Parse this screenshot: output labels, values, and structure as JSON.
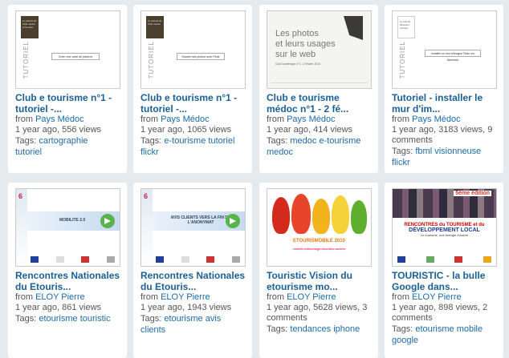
{
  "cards": [
    {
      "title": "Club e tourisme n°1 - tutoriel -...",
      "from_label": "from",
      "author": "Pays Médoc",
      "stats": "1 year ago, 556 views",
      "tags_label": "Tags:",
      "tags": [
        "cartographie",
        "tutoriel"
      ],
      "thumb": {
        "box_text": "Créer une carte de pictures",
        "vertical_text": "TUTORIEL",
        "block_text": "Le tutoriel du Club médoc et la carte"
      }
    },
    {
      "title": "Club e tourisme n°1 - tutoriel -...",
      "from_label": "from",
      "author": "Pays Médoc",
      "stats": "1 year ago, 1065 views",
      "tags_label": "Tags:",
      "tags": [
        "e-tourisme",
        "tutoriel",
        "flickr"
      ],
      "thumb": {
        "box_text": "Stocker ses photos avec Flickr",
        "vertical_text": "TUTORIEL",
        "block_text": "Le tutoriel du Club médoc"
      }
    },
    {
      "title": "Club e tourisme médoc n°1 - 2 fé...",
      "from_label": "from",
      "author": "Pays Médoc",
      "stats": "1 year ago, 414 views",
      "tags_label": "Tags:",
      "tags": [
        "medoc",
        "e-tourisme",
        "medoc"
      ],
      "thumb": {
        "big_text": "Les photos\net leurs usages\nsur le web",
        "small_text": "Club Numérique n°1 • 2 février 2010"
      }
    },
    {
      "title": "Tutoriel - installer le mur d'im...",
      "from_label": "from",
      "author": "Pays Médoc",
      "stats": "1 year ago, 3183 views, 9 comments",
      "tags_label": "Tags:",
      "tags": [
        "fbml",
        "visionneuse",
        "flickr"
      ],
      "thumb": {
        "box_text": "Installer un mur d'images Flickr sur facebook",
        "vertical_text": "TUTORIEL",
        "block_text": "Le tutoriel Réseaux sociaux"
      }
    },
    {
      "title": "Rencontres Nationales du Etouris...",
      "from_label": "from",
      "author": "ELOY Pierre",
      "stats": "1 year ago, 861 views",
      "tags_label": "Tags:",
      "tags": [
        "etourisme",
        "touristic"
      ],
      "thumb": {
        "bar_text": "MOBILITE 2.0"
      }
    },
    {
      "title": "Rencontres Nationales du Etouris...",
      "from_label": "from",
      "author": "ELOY Pierre",
      "stats": "1 year ago, 1943 views",
      "tags_label": "Tags:",
      "tags": [
        "etourisme",
        "avis",
        "clients"
      ],
      "thumb": {
        "bar_text": "AVIS CLIENTS VERS LA FIN DE L'ANONYMAT"
      }
    },
    {
      "title": "Touristic Vision du etourisme mo...",
      "from_label": "from",
      "author": "ELOY Pierre",
      "stats": "1 year ago, 5628 views, 3 comments",
      "tags_label": "Tags:",
      "tags": [
        "tendances",
        "iphone"
      ],
      "thumb": {
        "banner": "ETOURISMOBILE 2010",
        "sub": "mobilemultisocialgeotouristicmachine"
      }
    },
    {
      "title": "TOURISTIC - la bulle Google dans...",
      "from_label": "from",
      "author": "ELOY Pierre",
      "stats": "1 year ago, 898 views, 2 comments",
      "tags_label": "Tags:",
      "tags": [
        "etourisme",
        "mobile",
        "google"
      ],
      "thumb": {
        "edition": "5ème édition",
        "line1": "RENCONTRES du TOURISME et du",
        "line2": "DÉVELOPPEMENT LOCAL",
        "line3": "Le tourisme, une énergie d'avenir"
      }
    }
  ]
}
